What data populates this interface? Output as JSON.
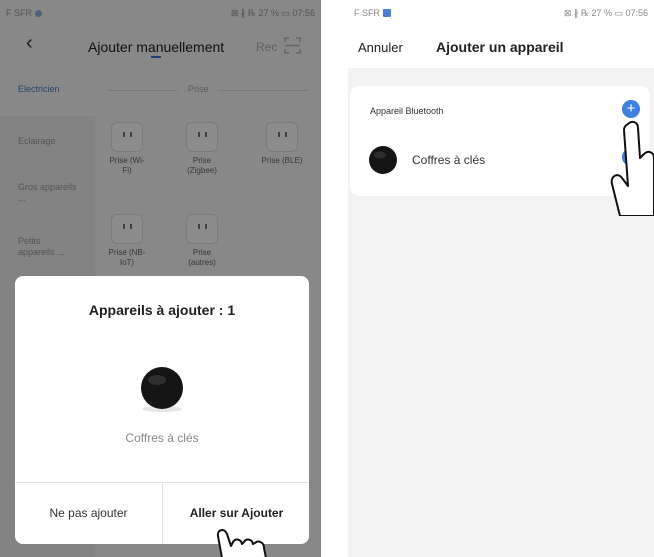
{
  "left_screen": {
    "status_bar": {
      "carrier": "F SFR",
      "right": "⊠ ∦ ℞ 27 % ▭ 07:56"
    },
    "header": {
      "title": "Ajouter manuellement",
      "rec_label": "Rec",
      "back_icon": "chevron-left-icon",
      "scan_icon": "scan-icon"
    },
    "category_tabs": {
      "active": "Electricien",
      "section": "Prise"
    },
    "sidebar_categories": [
      "Eclairage",
      "Gros appareils ...",
      "Petits appareils ..."
    ],
    "device_types": [
      "Prise (Wi-Fi)",
      "Prise (Zigbee)",
      "Prise (BLE)",
      "Prise (NB-IoT)",
      "Prise (autres)"
    ],
    "modal": {
      "title": "Appareils à ajouter : 1",
      "device_name": "Coffres à clés",
      "skip_button": "Ne pas ajouter",
      "go_button": "Aller sur Ajouter"
    }
  },
  "right_screen": {
    "status_bar": {
      "carrier": "F SFR",
      "right": "⊠ ∦ ℞ 27 % ▭ 07:56"
    },
    "header": {
      "cancel_label": "Annuler",
      "title": "Ajouter un appareil"
    },
    "bluetooth_card": {
      "title": "Appareil Bluetooth",
      "add_icon": "plus-circle-icon",
      "device_name": "Coffres à clés"
    }
  },
  "colors": {
    "accent": "#3f7fe0",
    "overlay": "rgba(0,0,0,0.45)"
  }
}
